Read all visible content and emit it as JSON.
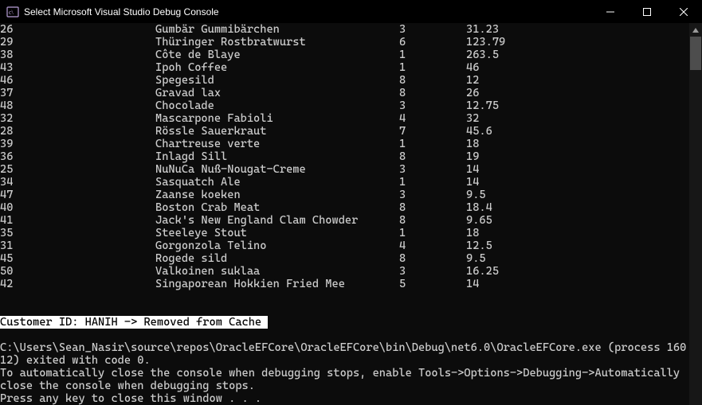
{
  "window": {
    "title": "Select Microsoft Visual Studio Debug Console"
  },
  "rows": [
    {
      "c1": "26",
      "c2": "Gumbär Gummibärchen",
      "c3": "3",
      "c4": "31.23"
    },
    {
      "c1": "29",
      "c2": "Thüringer Rostbratwurst",
      "c3": "6",
      "c4": "123.79"
    },
    {
      "c1": "38",
      "c2": "Côte de Blaye",
      "c3": "1",
      "c4": "263.5"
    },
    {
      "c1": "43",
      "c2": "Ipoh Coffee",
      "c3": "1",
      "c4": "46"
    },
    {
      "c1": "46",
      "c2": "Spegesild",
      "c3": "8",
      "c4": "12"
    },
    {
      "c1": "37",
      "c2": "Gravad lax",
      "c3": "8",
      "c4": "26"
    },
    {
      "c1": "48",
      "c2": "Chocolade",
      "c3": "3",
      "c4": "12.75"
    },
    {
      "c1": "32",
      "c2": "Mascarpone Fabioli",
      "c3": "4",
      "c4": "32"
    },
    {
      "c1": "28",
      "c2": "Rössle Sauerkraut",
      "c3": "7",
      "c4": "45.6"
    },
    {
      "c1": "39",
      "c2": "Chartreuse verte",
      "c3": "1",
      "c4": "18"
    },
    {
      "c1": "36",
      "c2": "Inlagd Sill",
      "c3": "8",
      "c4": "19"
    },
    {
      "c1": "25",
      "c2": "NuNuCa Nuß-Nougat-Creme",
      "c3": "3",
      "c4": "14"
    },
    {
      "c1": "34",
      "c2": "Sasquatch Ale",
      "c3": "1",
      "c4": "14"
    },
    {
      "c1": "47",
      "c2": "Zaanse koeken",
      "c3": "3",
      "c4": "9.5"
    },
    {
      "c1": "40",
      "c2": "Boston Crab Meat",
      "c3": "8",
      "c4": "18.4"
    },
    {
      "c1": "41",
      "c2": "Jack's New England Clam Chowder",
      "c3": "8",
      "c4": "9.65"
    },
    {
      "c1": "35",
      "c2": "Steeleye Stout",
      "c3": "1",
      "c4": "18"
    },
    {
      "c1": "31",
      "c2": "Gorgonzola Telino",
      "c3": "4",
      "c4": "12.5"
    },
    {
      "c1": "45",
      "c2": "Rogede sild",
      "c3": "8",
      "c4": "9.5"
    },
    {
      "c1": "50",
      "c2": "Valkoinen suklaa",
      "c3": "3",
      "c4": "16.25"
    },
    {
      "c1": "42",
      "c2": "Singaporean Hokkien Fried Mee",
      "c3": "5",
      "c4": "14"
    }
  ],
  "highlight_line": "Customer ID: HANIH -> Removed from Cache ",
  "footer": {
    "line1": "C:\\Users\\Sean_Nasir\\source\\repos\\OracleEFCore\\OracleEFCore\\bin\\Debug\\net6.0\\OracleEFCore.exe (process 16012) exited with code 0.",
    "line2": "To automatically close the console when debugging stops, enable Tools->Options->Debugging->Automatically close the console when debugging stops.",
    "line3": "Press any key to close this window . . ."
  }
}
